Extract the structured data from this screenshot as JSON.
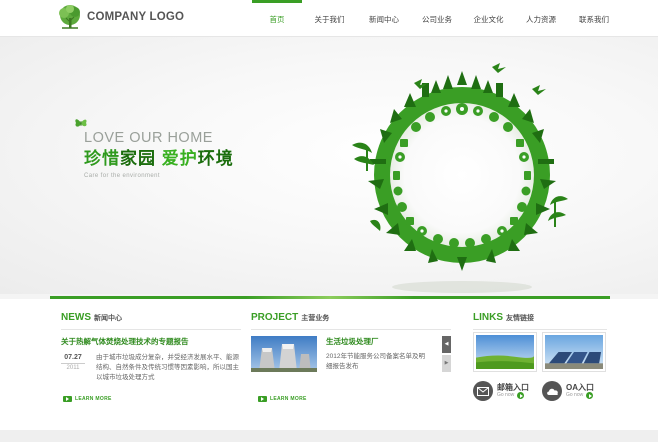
{
  "header": {
    "logo_text": "COMPANY LOGO",
    "nav": [
      {
        "label": "首页",
        "active": true
      },
      {
        "label": "关于我们",
        "active": false
      },
      {
        "label": "新闻中心",
        "active": false
      },
      {
        "label": "公司业务",
        "active": false
      },
      {
        "label": "企业文化",
        "active": false
      },
      {
        "label": "人力资源",
        "active": false
      },
      {
        "label": "联系我们",
        "active": false
      }
    ]
  },
  "hero": {
    "title_en": "LOVE OUR HOME",
    "title_cn_1": "珍惜",
    "title_cn_2": "家园",
    "title_cn_3": "爱护",
    "title_cn_4": "环境",
    "subtitle": "Care for the environment"
  },
  "news": {
    "title_en": "NEWS",
    "title_cn": "新闻中心",
    "headline": "关于热解气体焚烧处理技术的专题报告",
    "date_day": "07.27",
    "date_year": "2011",
    "body": "由于城市垃圾成分复杂，并受经济发展水平、能源结构、自然条件及传统习惯等因素影响，所以国主以城市垃圾处理方式",
    "learn_more": "LEARN MORE"
  },
  "project": {
    "title_en": "PROJECT",
    "title_cn": "主营业务",
    "name": "生活垃圾处理厂",
    "body": "2012年节能服务公司备案名单及明细报告发布",
    "learn_more": "LEARN MORE",
    "arrow_up": "◀",
    "arrow_down": "▶"
  },
  "links": {
    "title_en": "LINKS",
    "title_cn": "友情链接",
    "mail_label": "邮箱入口",
    "mail_go": "Go now",
    "oa_label": "OA入口",
    "oa_go": "Go now"
  },
  "colors": {
    "accent": "#3a9e25",
    "dark_green": "#1b6d0d",
    "text": "#555555"
  }
}
